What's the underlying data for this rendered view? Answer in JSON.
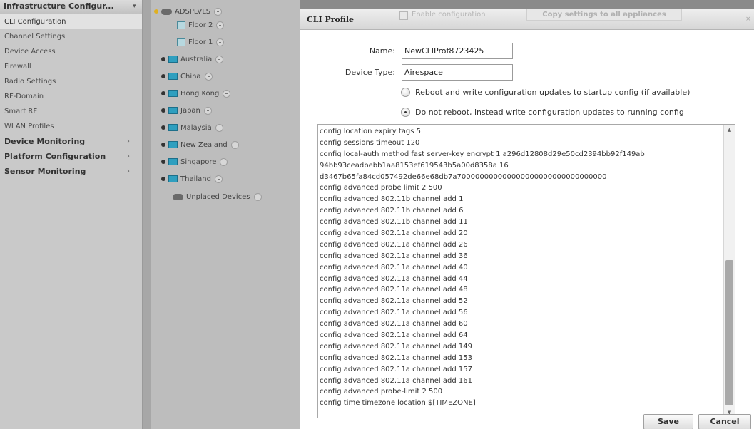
{
  "nav": {
    "header": "Infrastructure Configur...",
    "header_chevron": "▾",
    "items": [
      {
        "label": "CLI Configuration",
        "active": true
      },
      {
        "label": "Channel Settings"
      },
      {
        "label": "Device Access"
      },
      {
        "label": "Firewall"
      },
      {
        "label": "Radio Settings"
      },
      {
        "label": "RF-Domain"
      },
      {
        "label": "Smart RF"
      },
      {
        "label": "WLAN Profiles"
      }
    ],
    "sections": [
      {
        "label": "Device Monitoring",
        "arrow": "›"
      },
      {
        "label": "Platform Configuration",
        "arrow": "›"
      },
      {
        "label": "Sensor Monitoring",
        "arrow": "›"
      }
    ]
  },
  "tree": {
    "root": "ADSPLVLS",
    "floors": [
      "Floor 2",
      "Floor 1"
    ],
    "countries": [
      "Australia",
      "China",
      "Hong Kong",
      "Japan",
      "Malaysia",
      "New Zealand",
      "Singapore",
      "Thailand"
    ],
    "unplaced": "Unplaced Devices"
  },
  "modal": {
    "title": "CLI Profile",
    "enable_label": "Enable configuration",
    "copy_button": "Copy settings to all appliances",
    "close_glyph": "×",
    "name_label": "Name:",
    "name_value": "NewCLIProf8723425",
    "device_type_label": "Device Type:",
    "device_type_value": "Airespace",
    "radio_reboot": "Reboot and write configuration updates to startup config (if available)",
    "radio_no_reboot": "Do not reboot, instead write configuration updates to running config",
    "radio_selected": "no_reboot",
    "config_lines": [
      "config location expiry tags 5",
      "config sessions timeout 120",
      "config local-auth method fast server-key encrypt 1 a296d12808d29e50cd2394bb92f149ab",
      "94bb93ceadbebb1aa8153ef619543b5a00d8358a 16",
      "d3467b65fa84cd057492de66e68db7a700000000000000000000000000000000",
      "config advanced probe limit 2 500",
      "config advanced 802.11b channel add 1",
      "config advanced 802.11b channel add 6",
      "config advanced 802.11b channel add 11",
      "config advanced 802.11a channel add 20",
      "config advanced 802.11a channel add 26",
      "config advanced 802.11a channel add 36",
      "config advanced 802.11a channel add 40",
      "config advanced 802.11a channel add 44",
      "config advanced 802.11a channel add 48",
      "config advanced 802.11a channel add 52",
      "config advanced 802.11a channel add 56",
      "config advanced 802.11a channel add 60",
      "config advanced 802.11a channel add 64",
      "config advanced 802.11a channel add 149",
      "config advanced 802.11a channel add 153",
      "config advanced 802.11a channel add 157",
      "config advanced 802.11a channel add 161",
      "config advanced probe-limit 2 500",
      "config time timezone location $[TIMEZONE]"
    ],
    "scroll_up": "▲",
    "scroll_down": "▼",
    "save_button": "Save",
    "cancel_button": "Cancel"
  }
}
